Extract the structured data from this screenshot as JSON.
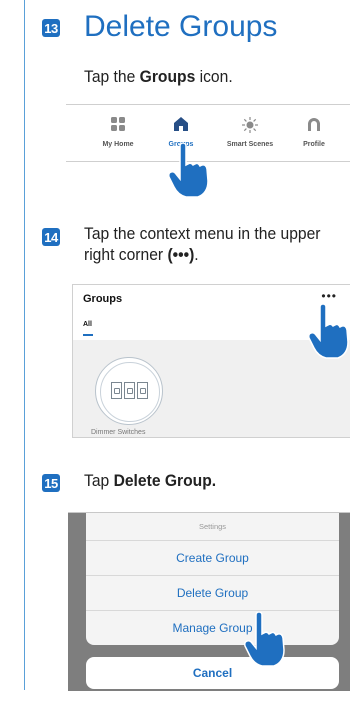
{
  "steps": [
    {
      "number": "13",
      "title": "Delete Groups",
      "instruction_pre": "Tap the ",
      "instruction_bold": "Groups",
      "instruction_post": " icon."
    },
    {
      "number": "14",
      "instruction_line1": "Tap the context menu in the upper",
      "instruction_line2_pre": "right corner ",
      "instruction_line2_bold": "(•••)",
      "instruction_line2_post": "."
    },
    {
      "number": "15",
      "instruction_pre": "Tap ",
      "instruction_bold": "Delete Group."
    }
  ],
  "nav": {
    "items": [
      {
        "label": "My Home",
        "icon": "grid-icon",
        "active": false
      },
      {
        "label": "Groups",
        "icon": "house-icon",
        "active": true
      },
      {
        "label": "Smart Scenes",
        "icon": "sun-icon",
        "active": false
      },
      {
        "label": "Profile",
        "icon": "profile-icon",
        "active": false
      }
    ]
  },
  "groups_screen": {
    "title": "Groups",
    "more": "•••",
    "tab": "All",
    "card_label": "Dimmer Switches"
  },
  "action_sheet": {
    "header": "Settings",
    "options": [
      "Create Group",
      "Delete Group",
      "Manage Group"
    ],
    "cancel": "Cancel"
  },
  "colors": {
    "accent": "#1f6fc0",
    "rule": "#5aa0d8",
    "hand": "#1f6fc0"
  }
}
